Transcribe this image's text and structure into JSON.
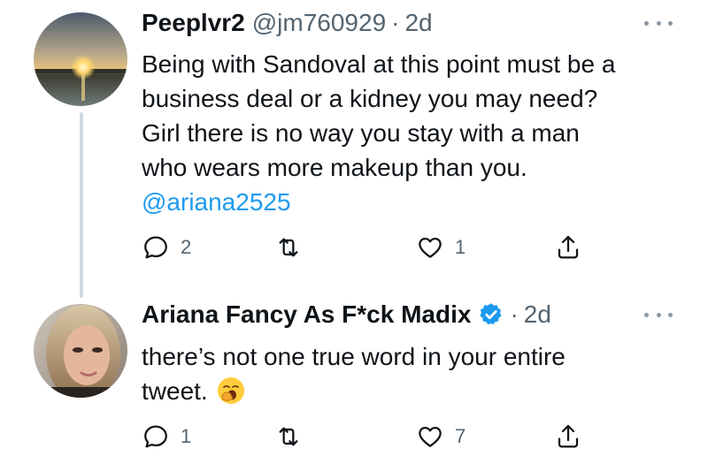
{
  "tweets": [
    {
      "name": "Peeplvr2",
      "handle": "@jm760929",
      "separator": "·",
      "time": "2d",
      "lines": [
        "Being with Sandoval at this point must be a",
        "business deal or a kidney you may need?",
        "Girl there is no way you stay with a man",
        "who wears more makeup than you."
      ],
      "mention": "@ariana2525",
      "replies": "2",
      "retweets": "",
      "likes": "1"
    },
    {
      "name": "Ariana Fancy As F*ck Madix",
      "separator": "·",
      "time": "2d",
      "lines": [
        "there’s not one true word in your entire",
        "tweet."
      ],
      "emoji": "yawning-face-emoji",
      "replies": "1",
      "retweets": "",
      "likes": "7"
    }
  ],
  "icons": {
    "more": "more-icon",
    "reply": "reply-icon",
    "retweet": "retweet-icon",
    "like": "like-icon",
    "share": "share-icon",
    "verified": "verified-badge-icon"
  },
  "colors": {
    "text": "#0f1419",
    "secondary": "#536471",
    "link": "#1d9bf0",
    "thread_line": "#cfd9de"
  }
}
